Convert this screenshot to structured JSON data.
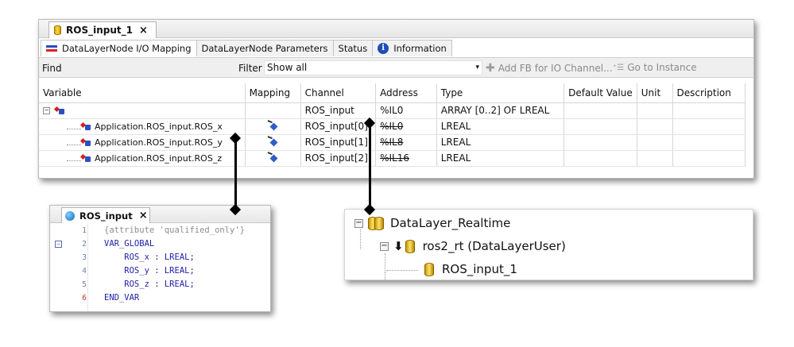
{
  "editor": {
    "doc_tab": {
      "title": "ROS_input_1",
      "close": "×",
      "icon": "cylinder-device-icon"
    },
    "sub_tabs": [
      {
        "label": "DataLayerNode I/O Mapping",
        "icon": "io-mapping-icon",
        "active": true
      },
      {
        "label": "DataLayerNode Parameters",
        "active": false
      },
      {
        "label": "Status",
        "active": false
      },
      {
        "label": "Information",
        "icon": "info-icon",
        "active": false
      }
    ],
    "toolbar": {
      "find_label": "Find",
      "find_value": "",
      "filter_label": "Filter",
      "filter_value": "Show all",
      "dropdown": "▾",
      "add_fb_label": "Add FB for IO Channel...",
      "goto_label": "Go to Instance"
    },
    "columns": [
      "Variable",
      "Mapping",
      "Channel",
      "Address",
      "Type",
      "Default Value",
      "Unit",
      "Description"
    ],
    "rows": [
      {
        "variable": "",
        "channel": "ROS_input",
        "address": "%IL0",
        "type": "ARRAY [0..2] OF LREAL",
        "mapped": false,
        "struck": false
      },
      {
        "variable": "Application.ROS_input.ROS_x",
        "channel": "ROS_input[0]",
        "address": "%IL0",
        "type": "LREAL",
        "mapped": true,
        "struck": true
      },
      {
        "variable": "Application.ROS_input.ROS_y",
        "channel": "ROS_input[1]",
        "address": "%IL8",
        "type": "LREAL",
        "mapped": true,
        "struck": true
      },
      {
        "variable": "Application.ROS_input.ROS_z",
        "channel": "ROS_input[2]",
        "address": "%IL16",
        "type": "LREAL",
        "mapped": true,
        "struck": true
      }
    ]
  },
  "code_editor": {
    "tab_title": "ROS_input",
    "close": "×",
    "icon": "globe-icon",
    "lines": [
      {
        "num": "1",
        "text": "{attribute 'qualified_only'}",
        "kind": "comment"
      },
      {
        "num": "2",
        "text": "VAR_GLOBAL",
        "kind": "keyword",
        "fold": "⊟"
      },
      {
        "num": "3",
        "text": "    ROS_x : LREAL;",
        "kind": "keyword"
      },
      {
        "num": "4",
        "text": "    ROS_y : LREAL;",
        "kind": "keyword"
      },
      {
        "num": "5",
        "text": "    ROS_z : LREAL;",
        "kind": "keyword"
      },
      {
        "num": "6",
        "text": "END_VAR",
        "kind": "keyword"
      }
    ]
  },
  "device_tree": {
    "nodes": [
      {
        "label": "DataLayer_Realtime",
        "icon": "database-icon",
        "level": 0
      },
      {
        "label": "ros2_rt (DataLayerUser)",
        "icon": "database-arrow-icon",
        "level": 1
      },
      {
        "label": "ROS_input_1",
        "icon": "database-icon",
        "level": 2
      }
    ]
  },
  "colors": {
    "keyword": "#1f1fa8",
    "comment": "#8e8e8e",
    "line_number": "#6b7fb3"
  }
}
